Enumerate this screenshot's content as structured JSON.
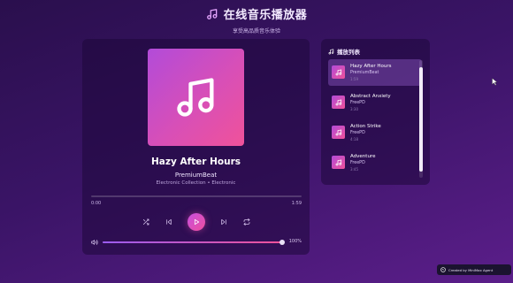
{
  "header": {
    "title": "在线音乐播放器",
    "subtitle": "享受高品质音乐体验"
  },
  "now_playing": {
    "title": "Hazy After Hours",
    "artist": "PremiumBeat",
    "album": "Electronic Collection • Electronic",
    "current_time": "0:00",
    "total_time": "1:59",
    "progress": 0.0
  },
  "controls": {
    "shuffle": "shuffle-icon",
    "previous": "previous-icon",
    "play": "play-icon",
    "next": "next-icon",
    "repeat": "repeat-icon"
  },
  "volume": {
    "level": 1.0,
    "label": "100%"
  },
  "playlist": {
    "title": "播放列表",
    "items": [
      {
        "name": "Hazy After Hours",
        "artist": "PremiumBeat",
        "duration": "1:59",
        "active": true
      },
      {
        "name": "Abstract Anxiety",
        "artist": "FreePD",
        "duration": "3:30",
        "active": false
      },
      {
        "name": "Action Strike",
        "artist": "FreePD",
        "duration": "4:18",
        "active": false
      },
      {
        "name": "Adventure",
        "artist": "FreePD",
        "duration": "3:45",
        "active": false
      }
    ]
  },
  "badge": {
    "text": "Created by MiniMax Agent"
  },
  "colors": {
    "accent_start": "#b24bd9",
    "accent_end": "#f0529a",
    "background": "#3a1466"
  }
}
